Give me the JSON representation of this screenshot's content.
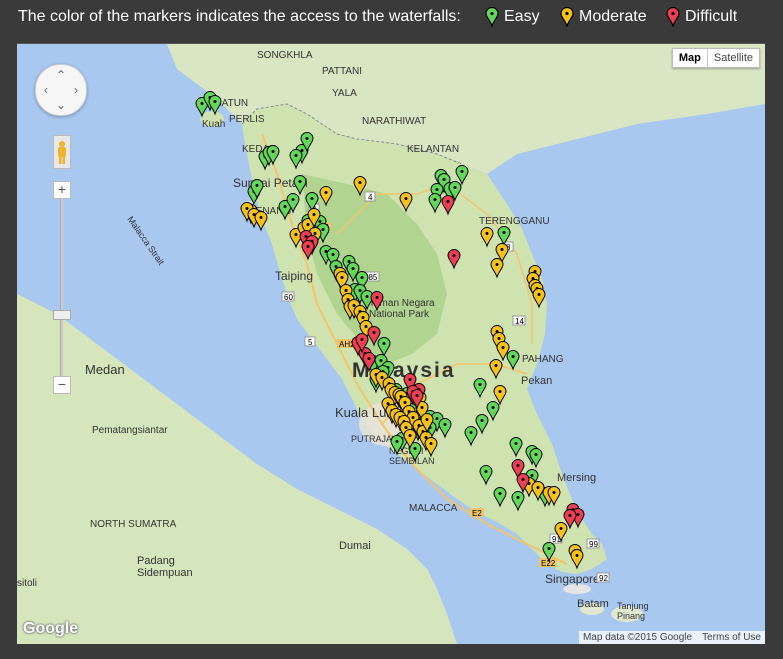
{
  "legend": {
    "text": "The color of the markers indicates the access to the waterfalls:",
    "items": [
      {
        "label": "Easy",
        "color": "#63d75a"
      },
      {
        "label": "Moderate",
        "color": "#f5c11a"
      },
      {
        "label": "Difficult",
        "color": "#ec3f52"
      }
    ]
  },
  "map_type": {
    "map": "Map",
    "satellite": "Satellite"
  },
  "zoom": {
    "in": "+",
    "out": "−"
  },
  "attribution": {
    "data": "Map data ©2015 Google",
    "terms": "Terms of Use"
  },
  "logo": "Google",
  "labels": {
    "songkhla": "SONGKHLA",
    "pattani": "PATTANI",
    "yala": "YALA",
    "narathiwat": "NARATHIWAT",
    "satun": "SATUN",
    "perlis": "PERLIS",
    "kuah": "Kuah",
    "kedah": "KEDAH",
    "kelantan": "KELANTAN",
    "sungai_petani": "Sungai Petani",
    "penang": "PENANG",
    "terengganu": "TERENGGANU",
    "malacca_strait": "Malacca Strait",
    "taiping": "Taiping",
    "taman_negara": "Taman Negara\nNational Park",
    "pahang": "PAHANG",
    "malaysia": "Malaysia",
    "medan": "Medan",
    "pekan": "Pekan",
    "kuala_lumpur": "Kuala Lumpur",
    "putrajaya": "PUTRAJAYA",
    "negeri_sembilan": "NEGERI\nSEMBILAN",
    "pematangsiantar": "Pematangsiantar",
    "mersing": "Mersing",
    "malacca": "MALACCA",
    "north_sumatra": "NORTH SUMATRA",
    "dumai": "Dumai",
    "padang_sidempuan": "Padang\nSidempuan",
    "singapore": "Singapore",
    "batam": "Batam",
    "tanjung_pinang": "Tanjung\nPinang",
    "sitoli": "sitoli",
    "road_76": "76",
    "road_185": "185",
    "road_4a": "4",
    "road_4b": "4",
    "road_60": "60",
    "road_5": "5",
    "road_ah2": "AH2",
    "road_14": "14",
    "road_e2": "E2",
    "road_e22": "E22",
    "road_91": "91",
    "road_92": "92",
    "road_99": "99",
    "road_8": "8"
  },
  "markers": {
    "easy": [
      [
        185,
        72
      ],
      [
        193,
        66
      ],
      [
        198,
        70
      ],
      [
        248,
        125
      ],
      [
        252,
        121
      ],
      [
        256,
        120
      ],
      [
        237,
        160
      ],
      [
        240,
        154
      ],
      [
        268,
        175
      ],
      [
        276,
        168
      ],
      [
        285,
        119
      ],
      [
        290,
        107
      ],
      [
        279,
        124
      ],
      [
        283,
        150
      ],
      [
        295,
        167
      ],
      [
        291,
        189
      ],
      [
        303,
        190
      ],
      [
        306,
        198
      ],
      [
        309,
        220
      ],
      [
        316,
        223
      ],
      [
        319,
        235
      ],
      [
        323,
        243
      ],
      [
        332,
        230
      ],
      [
        336,
        237
      ],
      [
        338,
        258
      ],
      [
        345,
        246
      ],
      [
        343,
        259
      ],
      [
        350,
        265
      ],
      [
        367,
        312
      ],
      [
        356,
        330
      ],
      [
        364,
        329
      ],
      [
        371,
        336
      ],
      [
        359,
        348
      ],
      [
        366,
        340
      ],
      [
        379,
        358
      ],
      [
        390,
        362
      ],
      [
        394,
        378
      ],
      [
        398,
        390
      ],
      [
        401,
        396
      ],
      [
        394,
        401
      ],
      [
        385,
        407
      ],
      [
        380,
        410
      ],
      [
        398,
        417
      ],
      [
        412,
        393
      ],
      [
        413,
        385
      ],
      [
        416,
        390
      ],
      [
        420,
        387
      ],
      [
        428,
        393
      ],
      [
        413,
        396
      ],
      [
        454,
        401
      ],
      [
        465,
        389
      ],
      [
        469,
        440
      ],
      [
        483,
        462
      ],
      [
        499,
        412
      ],
      [
        501,
        466
      ],
      [
        515,
        444
      ],
      [
        515,
        420
      ],
      [
        519,
        423
      ],
      [
        528,
        462
      ],
      [
        532,
        517
      ],
      [
        424,
        144
      ],
      [
        427,
        148
      ],
      [
        433,
        157
      ],
      [
        445,
        140
      ],
      [
        438,
        156
      ],
      [
        420,
        158
      ],
      [
        418,
        168
      ],
      [
        487,
        201
      ],
      [
        496,
        325
      ],
      [
        463,
        353
      ],
      [
        476,
        376
      ]
    ],
    "moderate": [
      [
        234,
        179
      ],
      [
        230,
        177
      ],
      [
        237,
        183
      ],
      [
        244,
        186
      ],
      [
        279,
        203
      ],
      [
        287,
        196
      ],
      [
        291,
        193
      ],
      [
        297,
        183
      ],
      [
        298,
        202
      ],
      [
        309,
        161
      ],
      [
        343,
        151
      ],
      [
        389,
        167
      ],
      [
        470,
        202
      ],
      [
        485,
        218
      ],
      [
        480,
        233
      ],
      [
        518,
        240
      ],
      [
        516,
        247
      ],
      [
        518,
        254
      ],
      [
        520,
        257
      ],
      [
        522,
        263
      ],
      [
        323,
        242
      ],
      [
        325,
        246
      ],
      [
        329,
        259
      ],
      [
        331,
        268
      ],
      [
        333,
        275
      ],
      [
        337,
        274
      ],
      [
        343,
        280
      ],
      [
        346,
        286
      ],
      [
        349,
        295
      ],
      [
        359,
        343
      ],
      [
        365,
        346
      ],
      [
        372,
        352
      ],
      [
        374,
        358
      ],
      [
        378,
        361
      ],
      [
        382,
        363
      ],
      [
        384,
        365
      ],
      [
        388,
        371
      ],
      [
        392,
        380
      ],
      [
        396,
        386
      ],
      [
        402,
        394
      ],
      [
        406,
        400
      ],
      [
        409,
        406
      ],
      [
        414,
        412
      ],
      [
        371,
        372
      ],
      [
        375,
        379
      ],
      [
        379,
        383
      ],
      [
        383,
        386
      ],
      [
        387,
        390
      ],
      [
        389,
        396
      ],
      [
        393,
        404
      ],
      [
        403,
        366
      ],
      [
        405,
        376
      ],
      [
        410,
        388
      ],
      [
        480,
        300
      ],
      [
        482,
        307
      ],
      [
        486,
        316
      ],
      [
        479,
        334
      ],
      [
        483,
        360
      ],
      [
        512,
        452
      ],
      [
        521,
        456
      ],
      [
        532,
        461
      ],
      [
        537,
        461
      ],
      [
        544,
        497
      ],
      [
        558,
        519
      ],
      [
        560,
        524
      ]
    ],
    "difficult": [
      [
        289,
        205
      ],
      [
        295,
        210
      ],
      [
        291,
        215
      ],
      [
        341,
        311
      ],
      [
        348,
        322
      ],
      [
        352,
        327
      ],
      [
        357,
        301
      ],
      [
        360,
        266
      ],
      [
        345,
        308
      ],
      [
        393,
        348
      ],
      [
        402,
        358
      ],
      [
        396,
        360
      ],
      [
        400,
        364
      ],
      [
        431,
        170
      ],
      [
        437,
        224
      ],
      [
        501,
        434
      ],
      [
        506,
        448
      ],
      [
        556,
        478
      ],
      [
        561,
        483
      ],
      [
        553,
        484
      ]
    ]
  }
}
